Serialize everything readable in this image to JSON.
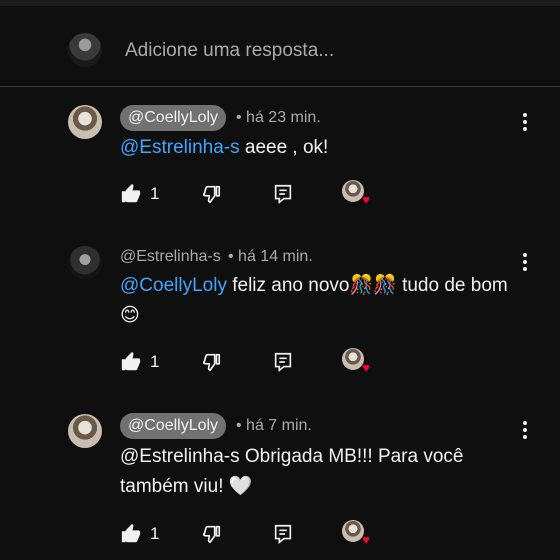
{
  "reply_box": {
    "placeholder": "Adicione uma resposta..."
  },
  "comments": [
    {
      "author": "@CoellyLoly",
      "time": "• há 23 min.",
      "mention": "@Estrelinha-s",
      "text": " aeee , ok!",
      "likes": "1"
    },
    {
      "author": "@Estrelinha-s",
      "time": "• há 14 min.",
      "mention": "@CoellyLoly",
      "text": " feliz ano novo🎊🎊 tudo de bom😊",
      "likes": "1"
    },
    {
      "author": "@CoellyLoly",
      "time": "• há 7 min.",
      "mention": "",
      "text": "@Estrelinha-s  Obrigada MB!!! Para você também viu! 🤍",
      "likes": "1"
    }
  ],
  "icons": {
    "like": "thumbs-up-icon",
    "dislike": "thumbs-down-icon",
    "reply": "reply-icon",
    "more": "more-vert-icon",
    "creator_heart": "heart-icon"
  },
  "colors": {
    "mention": "#3ea6ff",
    "heart": "#ff0033",
    "pill": "#717171"
  }
}
